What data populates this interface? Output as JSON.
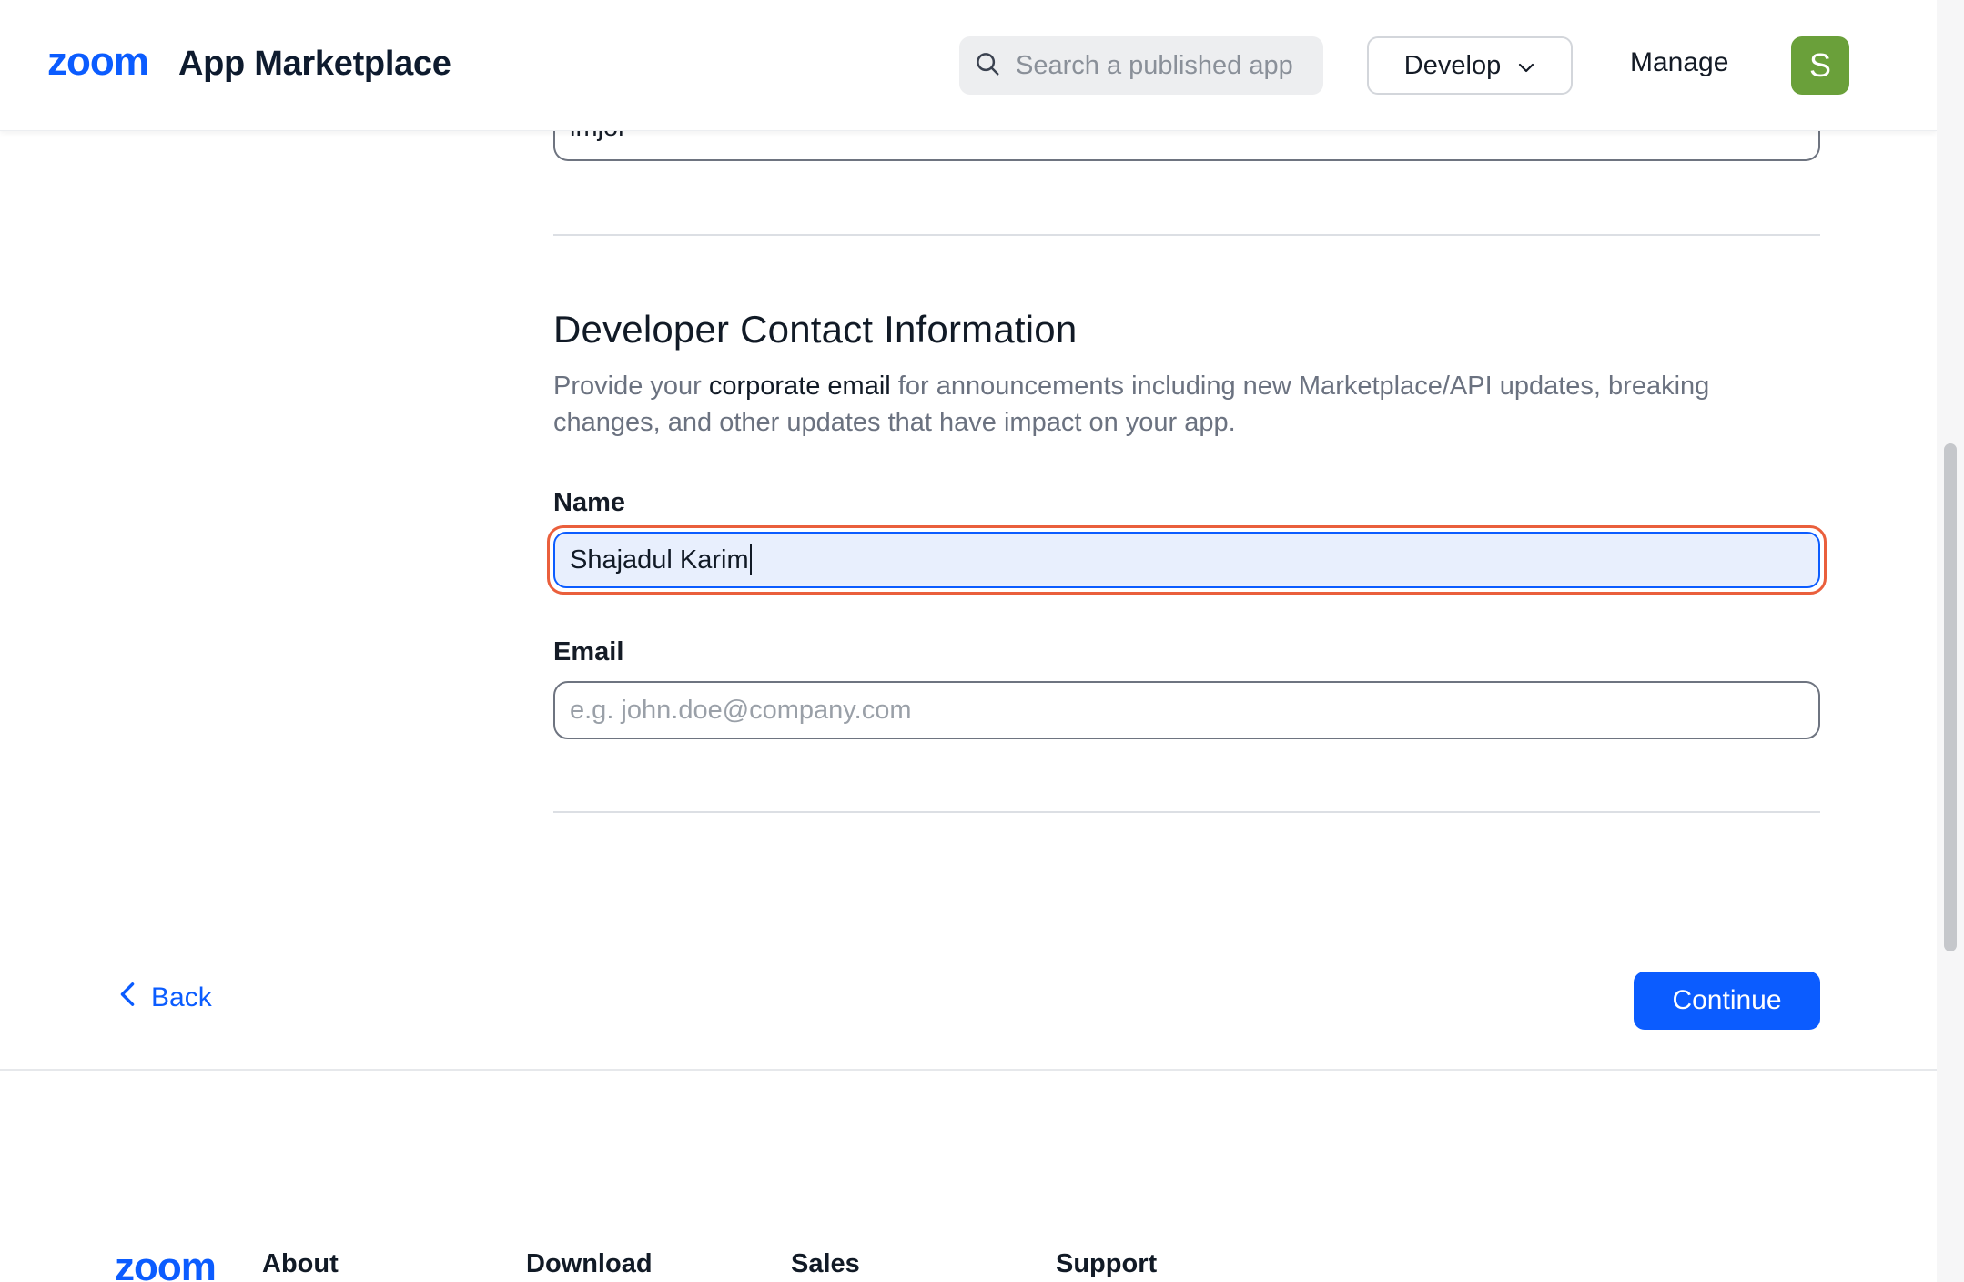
{
  "header": {
    "logo_text": "zoom",
    "title": "App Marketplace",
    "search_placeholder": "Search a published app",
    "develop_label": "Develop",
    "manage_label": "Manage",
    "avatar_initial": "S",
    "avatar_color": "#6aa03a"
  },
  "company": {
    "field_value": "imjoi"
  },
  "developer_contact": {
    "title": "Developer Contact Information",
    "description_prefix": "Provide your ",
    "description_emphasis": "corporate email",
    "description_suffix": " for announcements including new Marketplace/API updates, breaking changes, and other updates that have impact on your app.",
    "name_label": "Name",
    "name_value": "Shajadul Karim",
    "email_label": "Email",
    "email_placeholder": "e.g. john.doe@company.com"
  },
  "navigation": {
    "back_label": "Back",
    "continue_label": "Continue"
  },
  "footer": {
    "logo_text": "zoom",
    "columns": [
      "About",
      "Download",
      "Sales",
      "Support"
    ]
  },
  "colors": {
    "accent": "#0b5cff",
    "focus_ring": "#ea5f3c",
    "input_focus_bg": "#e8effd"
  }
}
